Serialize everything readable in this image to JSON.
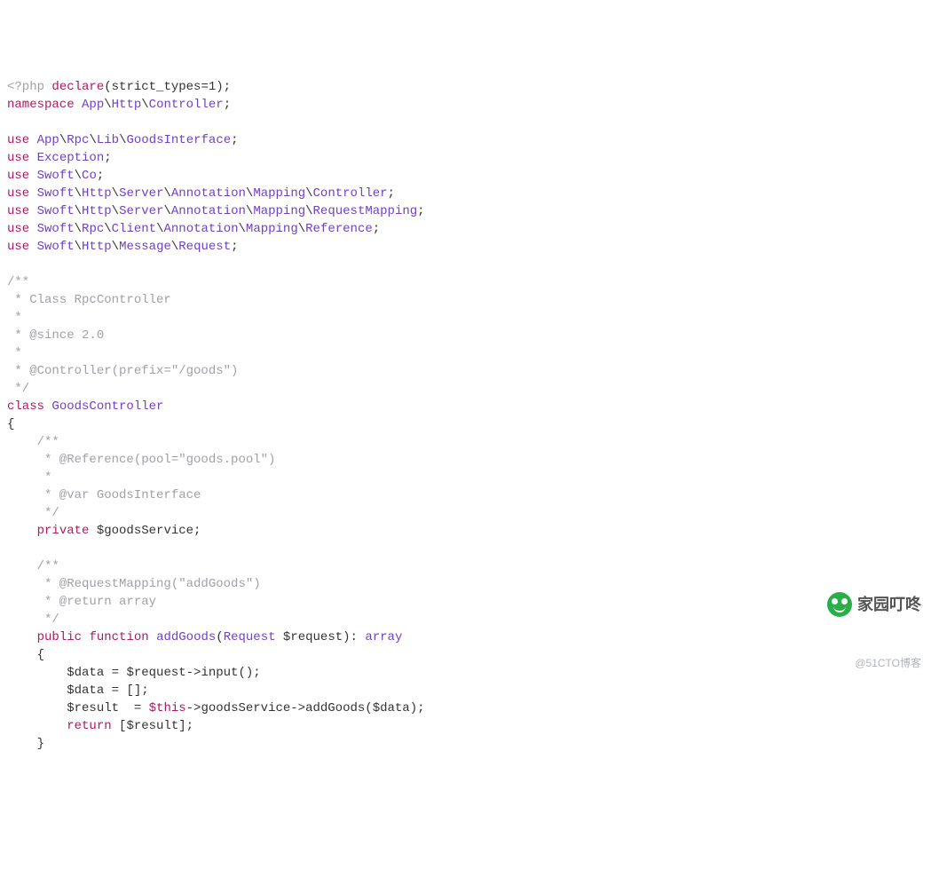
{
  "code": {
    "php_open": "<?php",
    "declare_kw": "declare",
    "strict": "(strict_types=1);",
    "namespace_kw": "namespace",
    "ns_app": "App",
    "ns_http": "Http",
    "ns_controller": "Controller",
    "use_kw": "use",
    "semi": ";",
    "u1_p1": "App",
    "u1_p2": "Rpc",
    "u1_p3": "Lib",
    "u1_p4": "GoodsInterface",
    "u2_p1": "Exception",
    "u3_p1": "Swoft",
    "u3_p2": "Co",
    "u4_p1": "Swoft",
    "u4_p2": "Http",
    "u4_p3": "Server",
    "u4_p4": "Annotation",
    "u4_p5": "Mapping",
    "u4_p6": "Controller",
    "u5_p6": "RequestMapping",
    "u6_p2": "Rpc",
    "u6_p3": "Client",
    "u6_p6": "Reference",
    "u7_p3": "Message",
    "u7_p4": "Request",
    "doc1_open": "/**",
    "doc1_l1": " * Class RpcController",
    "doc1_l2": " *",
    "doc1_l3": " * @since 2.0",
    "doc1_l4": " *",
    "doc1_l5": " * @Controller(prefix=\"/goods\")",
    "doc1_close": " */",
    "class_kw": "class",
    "class_name": "GoodsController",
    "obrace": "{",
    "cbrace": "}",
    "doc2_open": "    /**",
    "doc2_l1": "     * @Reference(pool=\"goods.pool\")",
    "doc2_l2": "     *",
    "doc2_l3": "     * @var GoodsInterface",
    "doc2_close": "     */",
    "private_kw": "private",
    "prop": "$goodsService",
    "doc3_open": "    /**",
    "doc3_l1": "     * @RequestMapping(\"addGoods\")",
    "doc3_l2": "     * @return array",
    "doc3_close": "     */",
    "public_kw": "public",
    "function_kw": "function",
    "method_name": "addGoods",
    "param_type": "Request",
    "param_var": "$request",
    "ret_type": "array",
    "body_l1_var": "$data",
    "body_l1_rest": " = $request->input();",
    "body_l2": "        $data = [];",
    "body_l3_a": "        $result  = ",
    "body_l3_this": "$this",
    "body_l3_b": "->goodsService->addGoods($data);",
    "return_kw": "return",
    "return_rest": " [$result];"
  },
  "watermark": {
    "title": "家园叮咚",
    "subtitle": "@51CTO博客"
  }
}
